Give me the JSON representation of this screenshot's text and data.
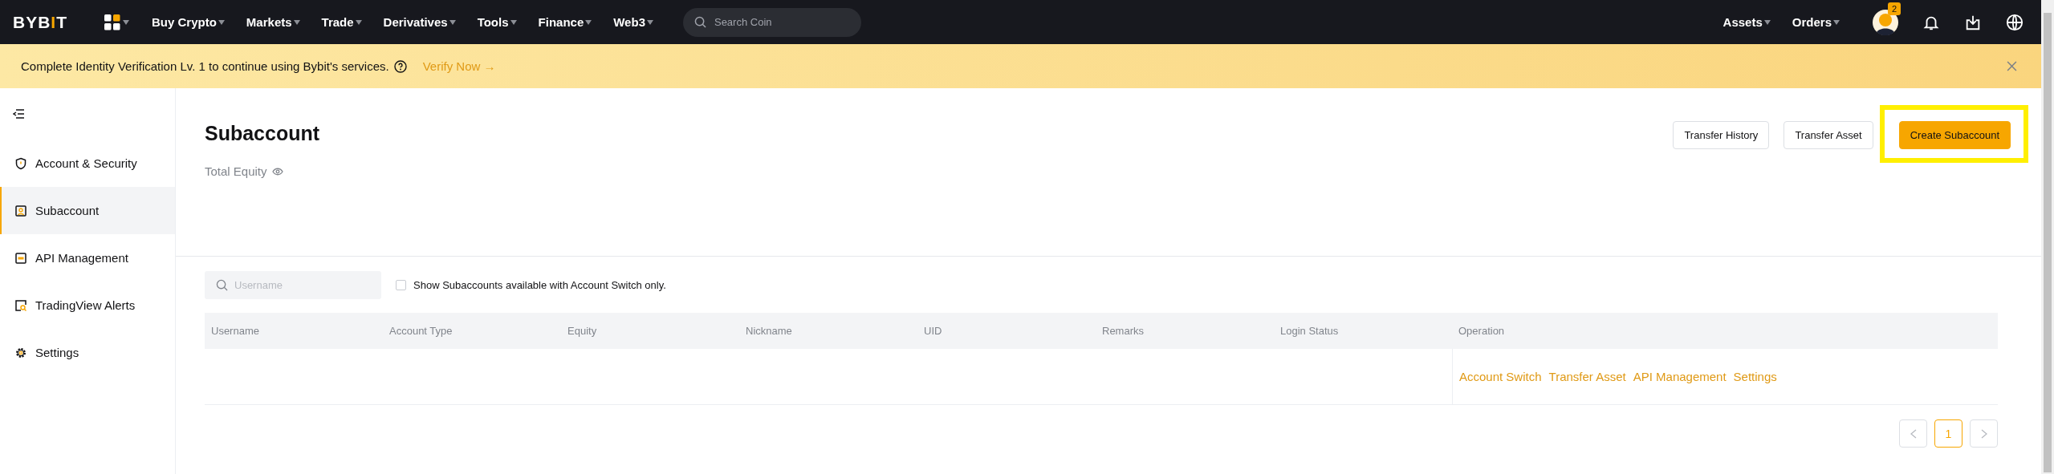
{
  "nav": {
    "logo": [
      {
        "text": "BYB",
        "accent": false
      },
      {
        "text": "I",
        "accent": true
      },
      {
        "text": "T",
        "accent": false
      }
    ],
    "menu": [
      {
        "label": "Buy Crypto"
      },
      {
        "label": "Markets"
      },
      {
        "label": "Trade"
      },
      {
        "label": "Derivatives"
      },
      {
        "label": "Tools"
      },
      {
        "label": "Finance"
      },
      {
        "label": "Web3"
      }
    ],
    "search": {
      "placeholder": "Search Coin"
    },
    "right_menu": [
      {
        "label": "Assets"
      },
      {
        "label": "Orders"
      }
    ],
    "notification_count": "2"
  },
  "banner": {
    "message": "Complete Identity Verification Lv. 1 to continue using Bybit's services.",
    "link": "Verify Now",
    "link_arrow": "→"
  },
  "sidebar": {
    "items": [
      {
        "label": "Account & Security",
        "kind": "shield",
        "selected": false
      },
      {
        "label": "Subaccount",
        "kind": "user",
        "selected": true
      },
      {
        "label": "API Management",
        "kind": "api",
        "selected": false
      },
      {
        "label": "TradingView Alerts",
        "kind": "alert",
        "selected": false
      },
      {
        "label": "Settings",
        "kind": "gear",
        "selected": false
      }
    ]
  },
  "page": {
    "title": "Subaccount",
    "total_equity_label": "Total Equity",
    "actions": [
      {
        "label": "Transfer History",
        "primary": false,
        "highlighted": false
      },
      {
        "label": "Transfer Asset",
        "primary": false,
        "highlighted": false
      },
      {
        "label": "Create Subaccount",
        "primary": true,
        "highlighted": true
      }
    ]
  },
  "filter": {
    "search": {
      "placeholder": "Username"
    },
    "checkbox": {
      "label": "Show Subaccounts available with Account Switch only.",
      "checked": false
    }
  },
  "table": {
    "columns": [
      "Username",
      "Account Type",
      "Equity",
      "Nickname",
      "UID",
      "Remarks",
      "Login Status",
      "Operation"
    ],
    "operations": [
      "Account Switch",
      "Transfer Asset",
      "API Management",
      "Settings"
    ]
  },
  "pagination": {
    "pages": [
      {
        "label": "1",
        "selected": true
      }
    ]
  }
}
